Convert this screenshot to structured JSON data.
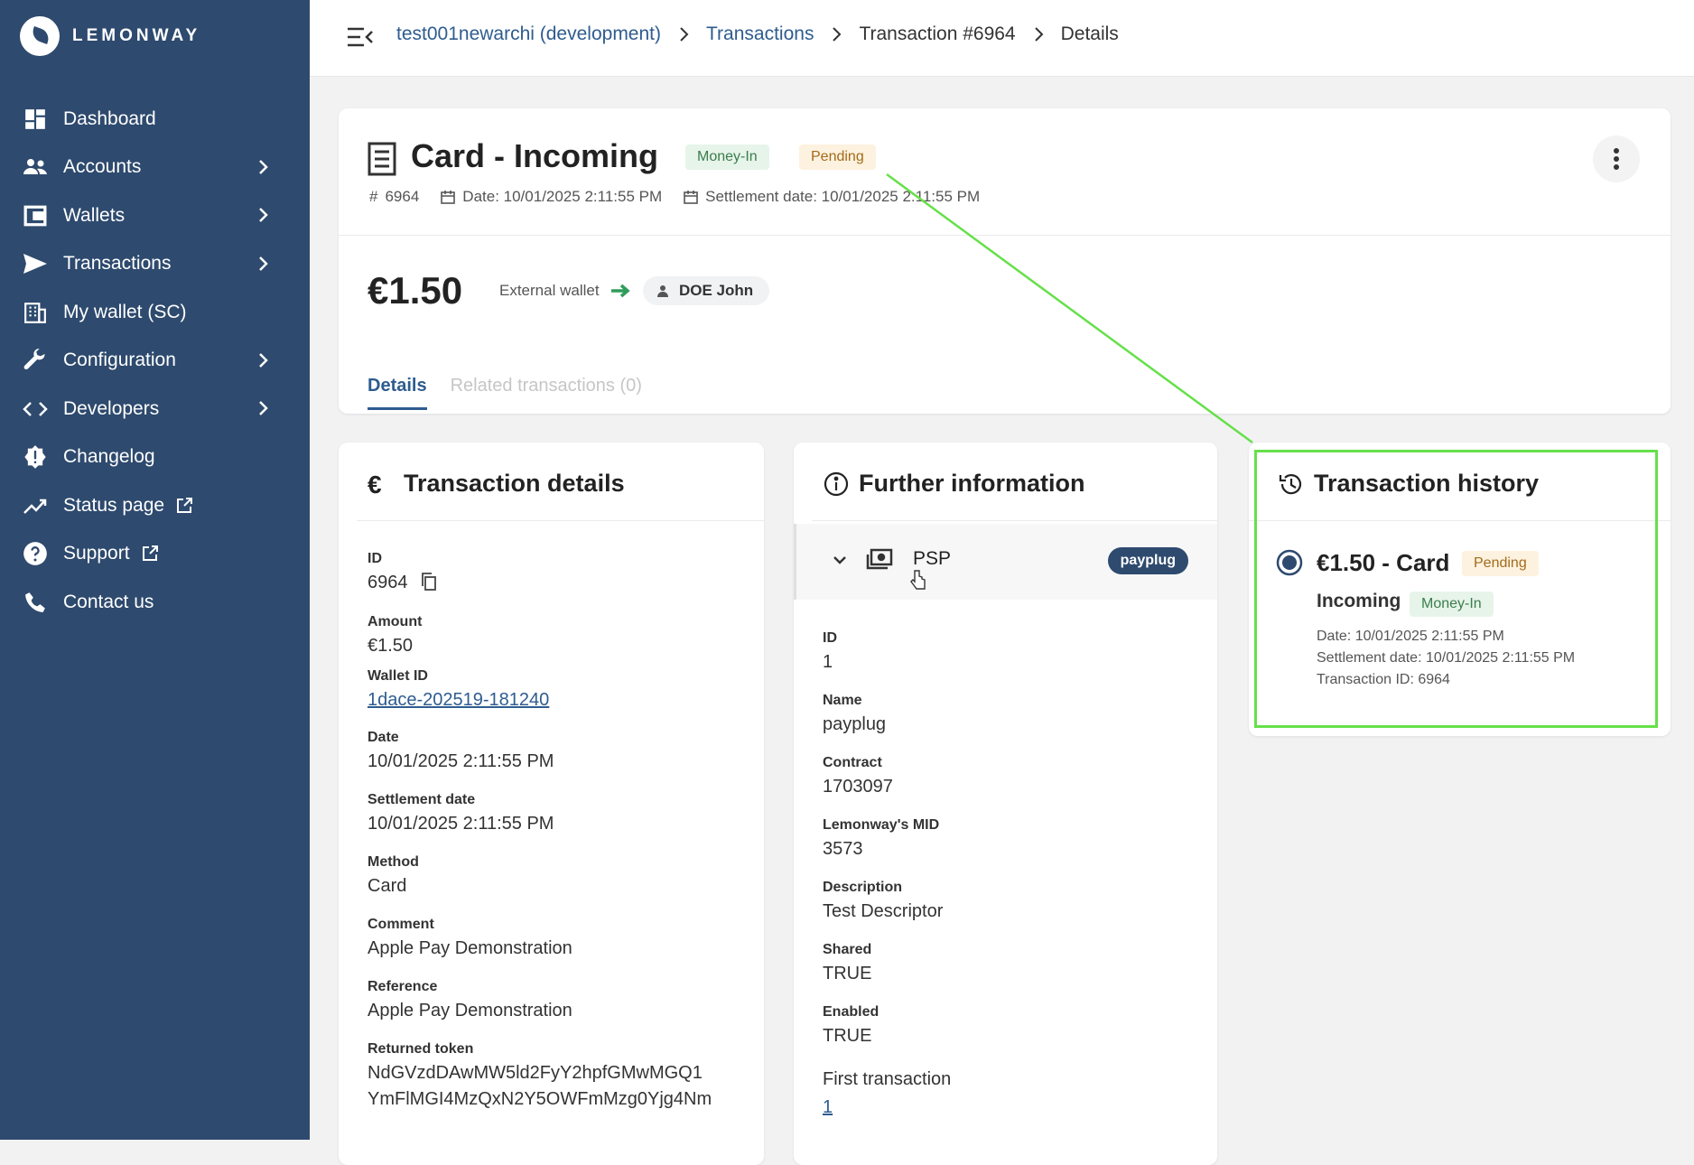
{
  "brand": {
    "name": "LEMONWAY"
  },
  "sidebar": {
    "items": [
      {
        "label": "Dashboard",
        "icon": "dashboard-icon",
        "chevron": false
      },
      {
        "label": "Accounts",
        "icon": "users-icon",
        "chevron": true
      },
      {
        "label": "Wallets",
        "icon": "wallet-icon",
        "chevron": true
      },
      {
        "label": "Transactions",
        "icon": "send-icon",
        "chevron": true
      },
      {
        "label": "My wallet (SC)",
        "icon": "building-icon",
        "chevron": false
      },
      {
        "label": "Configuration",
        "icon": "wrench-icon",
        "chevron": true
      },
      {
        "label": "Developers",
        "icon": "code-icon",
        "chevron": true
      },
      {
        "label": "Changelog",
        "icon": "badge-alert-icon",
        "chevron": false
      },
      {
        "label": "Status page",
        "icon": "trend-icon",
        "chevron": false,
        "external": true
      },
      {
        "label": "Support",
        "icon": "help-icon",
        "chevron": false,
        "external": true
      },
      {
        "label": "Contact us",
        "icon": "phone-icon",
        "chevron": false
      }
    ]
  },
  "breadcrumb": {
    "items": [
      "test001newarchi (development)",
      "Transactions",
      "Transaction #6964",
      "Details"
    ]
  },
  "header": {
    "title": "Card - Incoming",
    "badge_type": "Money-In",
    "badge_status": "Pending",
    "id_label": "6964",
    "date": "Date: 10/01/2025 2:11:55 PM",
    "settlement": "Settlement date: 10/01/2025 2:11:55 PM",
    "amount": "€1.50",
    "source": "External wallet",
    "recipient": "DOE John"
  },
  "tabs": [
    {
      "label": "Details",
      "active": true
    },
    {
      "label": "Related transactions (0)",
      "active": false
    }
  ],
  "transaction_details": {
    "title": "Transaction details",
    "fields": [
      {
        "label": "ID",
        "value": "6964"
      },
      {
        "label": "Amount",
        "value": "€1.50"
      },
      {
        "label": "Wallet ID",
        "value": "1dace-202519-181240"
      },
      {
        "label": "Date",
        "value": "10/01/2025 2:11:55 PM"
      },
      {
        "label": "Settlement date",
        "value": "10/01/2025 2:11:55 PM"
      },
      {
        "label": "Method",
        "value": "Card"
      },
      {
        "label": "Comment",
        "value": "Apple Pay Demonstration"
      },
      {
        "label": "Reference",
        "value": "Apple Pay Demonstration"
      },
      {
        "label": "Returned token",
        "value": "NdGVzdDAwMW5ld2FyY2hpfGMwMGQ1",
        "value2": "YmFlMGI4MzQxN2Y5OWFmMzg0Yjg4Nm"
      }
    ]
  },
  "further_info": {
    "title": "Further information",
    "psp_label": "PSP",
    "psp_pill": "payplug",
    "fields": [
      {
        "label": "ID",
        "value": "1"
      },
      {
        "label": "Name",
        "value": "payplug"
      },
      {
        "label": "Contract",
        "value": "1703097"
      },
      {
        "label": "Lemonway's MID",
        "value": "3573"
      },
      {
        "label": "Description",
        "value": "Test Descriptor"
      },
      {
        "label": "Shared",
        "value": "TRUE"
      },
      {
        "label": "Enabled",
        "value": "TRUE"
      }
    ],
    "first_transaction_label": "First transaction",
    "first_transaction_value": "1"
  },
  "history": {
    "title": "Transaction history",
    "entry_title": "€1.50 - Card",
    "entry_status": "Pending",
    "entry_sub": "Incoming",
    "entry_type": "Money-In",
    "date": "Date: 10/01/2025 2:11:55 PM",
    "settlement": "Settlement date: 10/01/2025 2:11:55 PM",
    "txid": "Transaction ID: 6964"
  },
  "colors": {
    "sidebar": "#2e4a6e",
    "link": "#2e5c8f",
    "highlight": "#66e04a"
  }
}
